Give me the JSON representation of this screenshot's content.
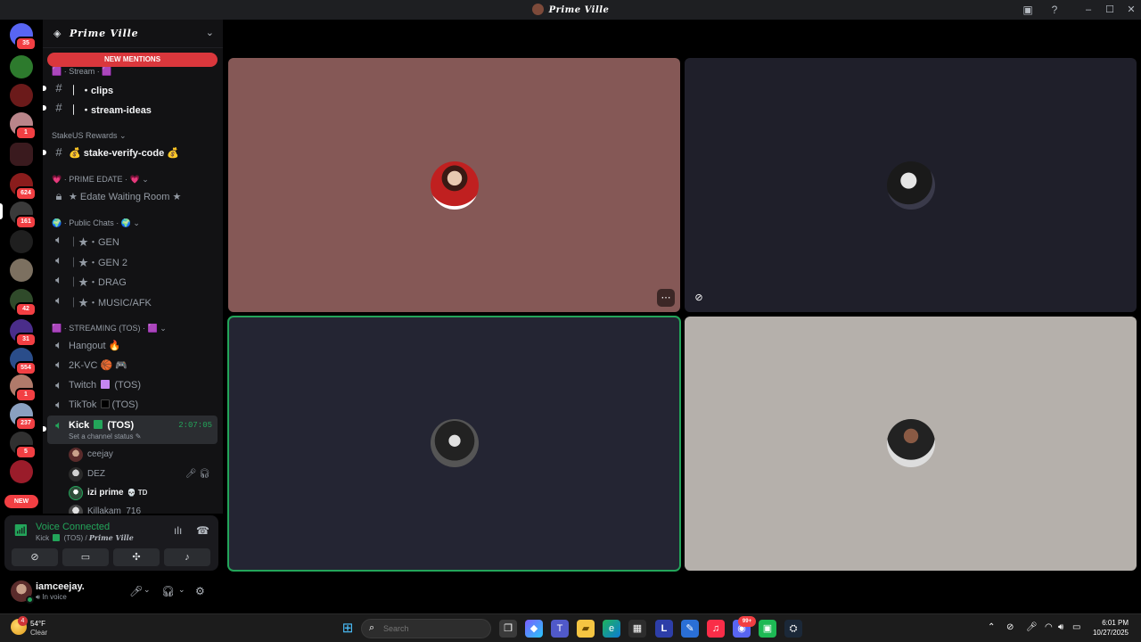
{
  "window": {
    "title": "Prime Ville"
  },
  "servers": [
    {
      "badge": "35",
      "color": "#5865f2"
    },
    {
      "badge": "",
      "color": "#2d7a2d"
    },
    {
      "badge": "",
      "color": "#6b1a1a"
    },
    {
      "badge": "1",
      "color": "#b9858a"
    },
    {
      "badge": "",
      "color": "#d83c3e"
    },
    {
      "badge": "624",
      "color": "#8a1c1c"
    },
    {
      "badge": "161",
      "color": "#3a3a3a"
    },
    {
      "badge": "",
      "color": "#1f1f1f"
    },
    {
      "badge": "",
      "color": "#7c7060"
    },
    {
      "badge": "42",
      "color": "#2f4a2a"
    },
    {
      "badge": "31",
      "color": "#4a2d8a"
    },
    {
      "badge": "554",
      "color": "#2a4d8a"
    },
    {
      "badge": "1",
      "color": "#b07a6a"
    },
    {
      "badge": "237",
      "color": "#8aa0c0"
    },
    {
      "badge": "5",
      "color": "#303030"
    },
    {
      "badge": "",
      "color": "#9a1c2a"
    }
  ],
  "new_badge": "NEW",
  "guild": {
    "name": "Prime Ville",
    "new_mentions": "NEW MENTIONS"
  },
  "categories": {
    "stream": "🟪 · Stream · 🟪",
    "stakeus": "StakeUS Rewards ⌄",
    "prime_edate": "💗 · PRIME EDATE · 💗 ⌄",
    "public_chats": "🌍 · Public Chats · 🌍 ⌄",
    "streaming": "🟪 · STREAMING (TOS) · 🟪 ⌄"
  },
  "channels": {
    "clips": "｜ ・clips",
    "stream_ideas": "｜ ・stream-ideas",
    "stake_verify": "💰 stake-verify-code 💰",
    "edate_room": "★ Edate Waiting Room ★",
    "gen": "｜★・GEN",
    "gen2": "｜★・GEN 2",
    "drag": "｜★・DRAG",
    "music": "｜★・MUSIC/AFK",
    "hangout": "Hangout 🔥",
    "vc2k": "2K-VC 🏀 🎮",
    "twitch_pre": "Twitch",
    "twitch_post": "(TOS)",
    "tiktok_pre": "TikTok",
    "tiktok_post": "(TOS)",
    "kick_pre": "Kick",
    "kick_post": "(TOS)",
    "kick_status": "Set a channel status ✎",
    "kick_timer": "2:07:05"
  },
  "voice_users": [
    {
      "name": "ceejay",
      "tag": ""
    },
    {
      "name": "DEZ",
      "tag": ""
    },
    {
      "name": "izi prime",
      "tag": "💀 TD"
    },
    {
      "name": "Killakam_716",
      "tag": ""
    }
  ],
  "voice_panel": {
    "title": "Voice Connected",
    "sub_channel": "Kick",
    "sub_tos": "(TOS) /",
    "sub_server": "Prime Ville"
  },
  "user": {
    "name": "iamceejay.",
    "status": "In voice"
  },
  "taskbar": {
    "weather_badge": "4",
    "temp": "54°F",
    "condition": "Clear",
    "search_placeholder": "Search",
    "time": "6:01 PM",
    "date": "10/27/2025",
    "discord_badge": "99+"
  },
  "colors": {
    "accent_green": "#23a55a",
    "mention_red": "#da373c",
    "tile1_bg": "#855856",
    "tile2_bg": "#1f1f2a",
    "tile3_bg": "#242533",
    "tile4_bg": "#b5b0ab"
  }
}
